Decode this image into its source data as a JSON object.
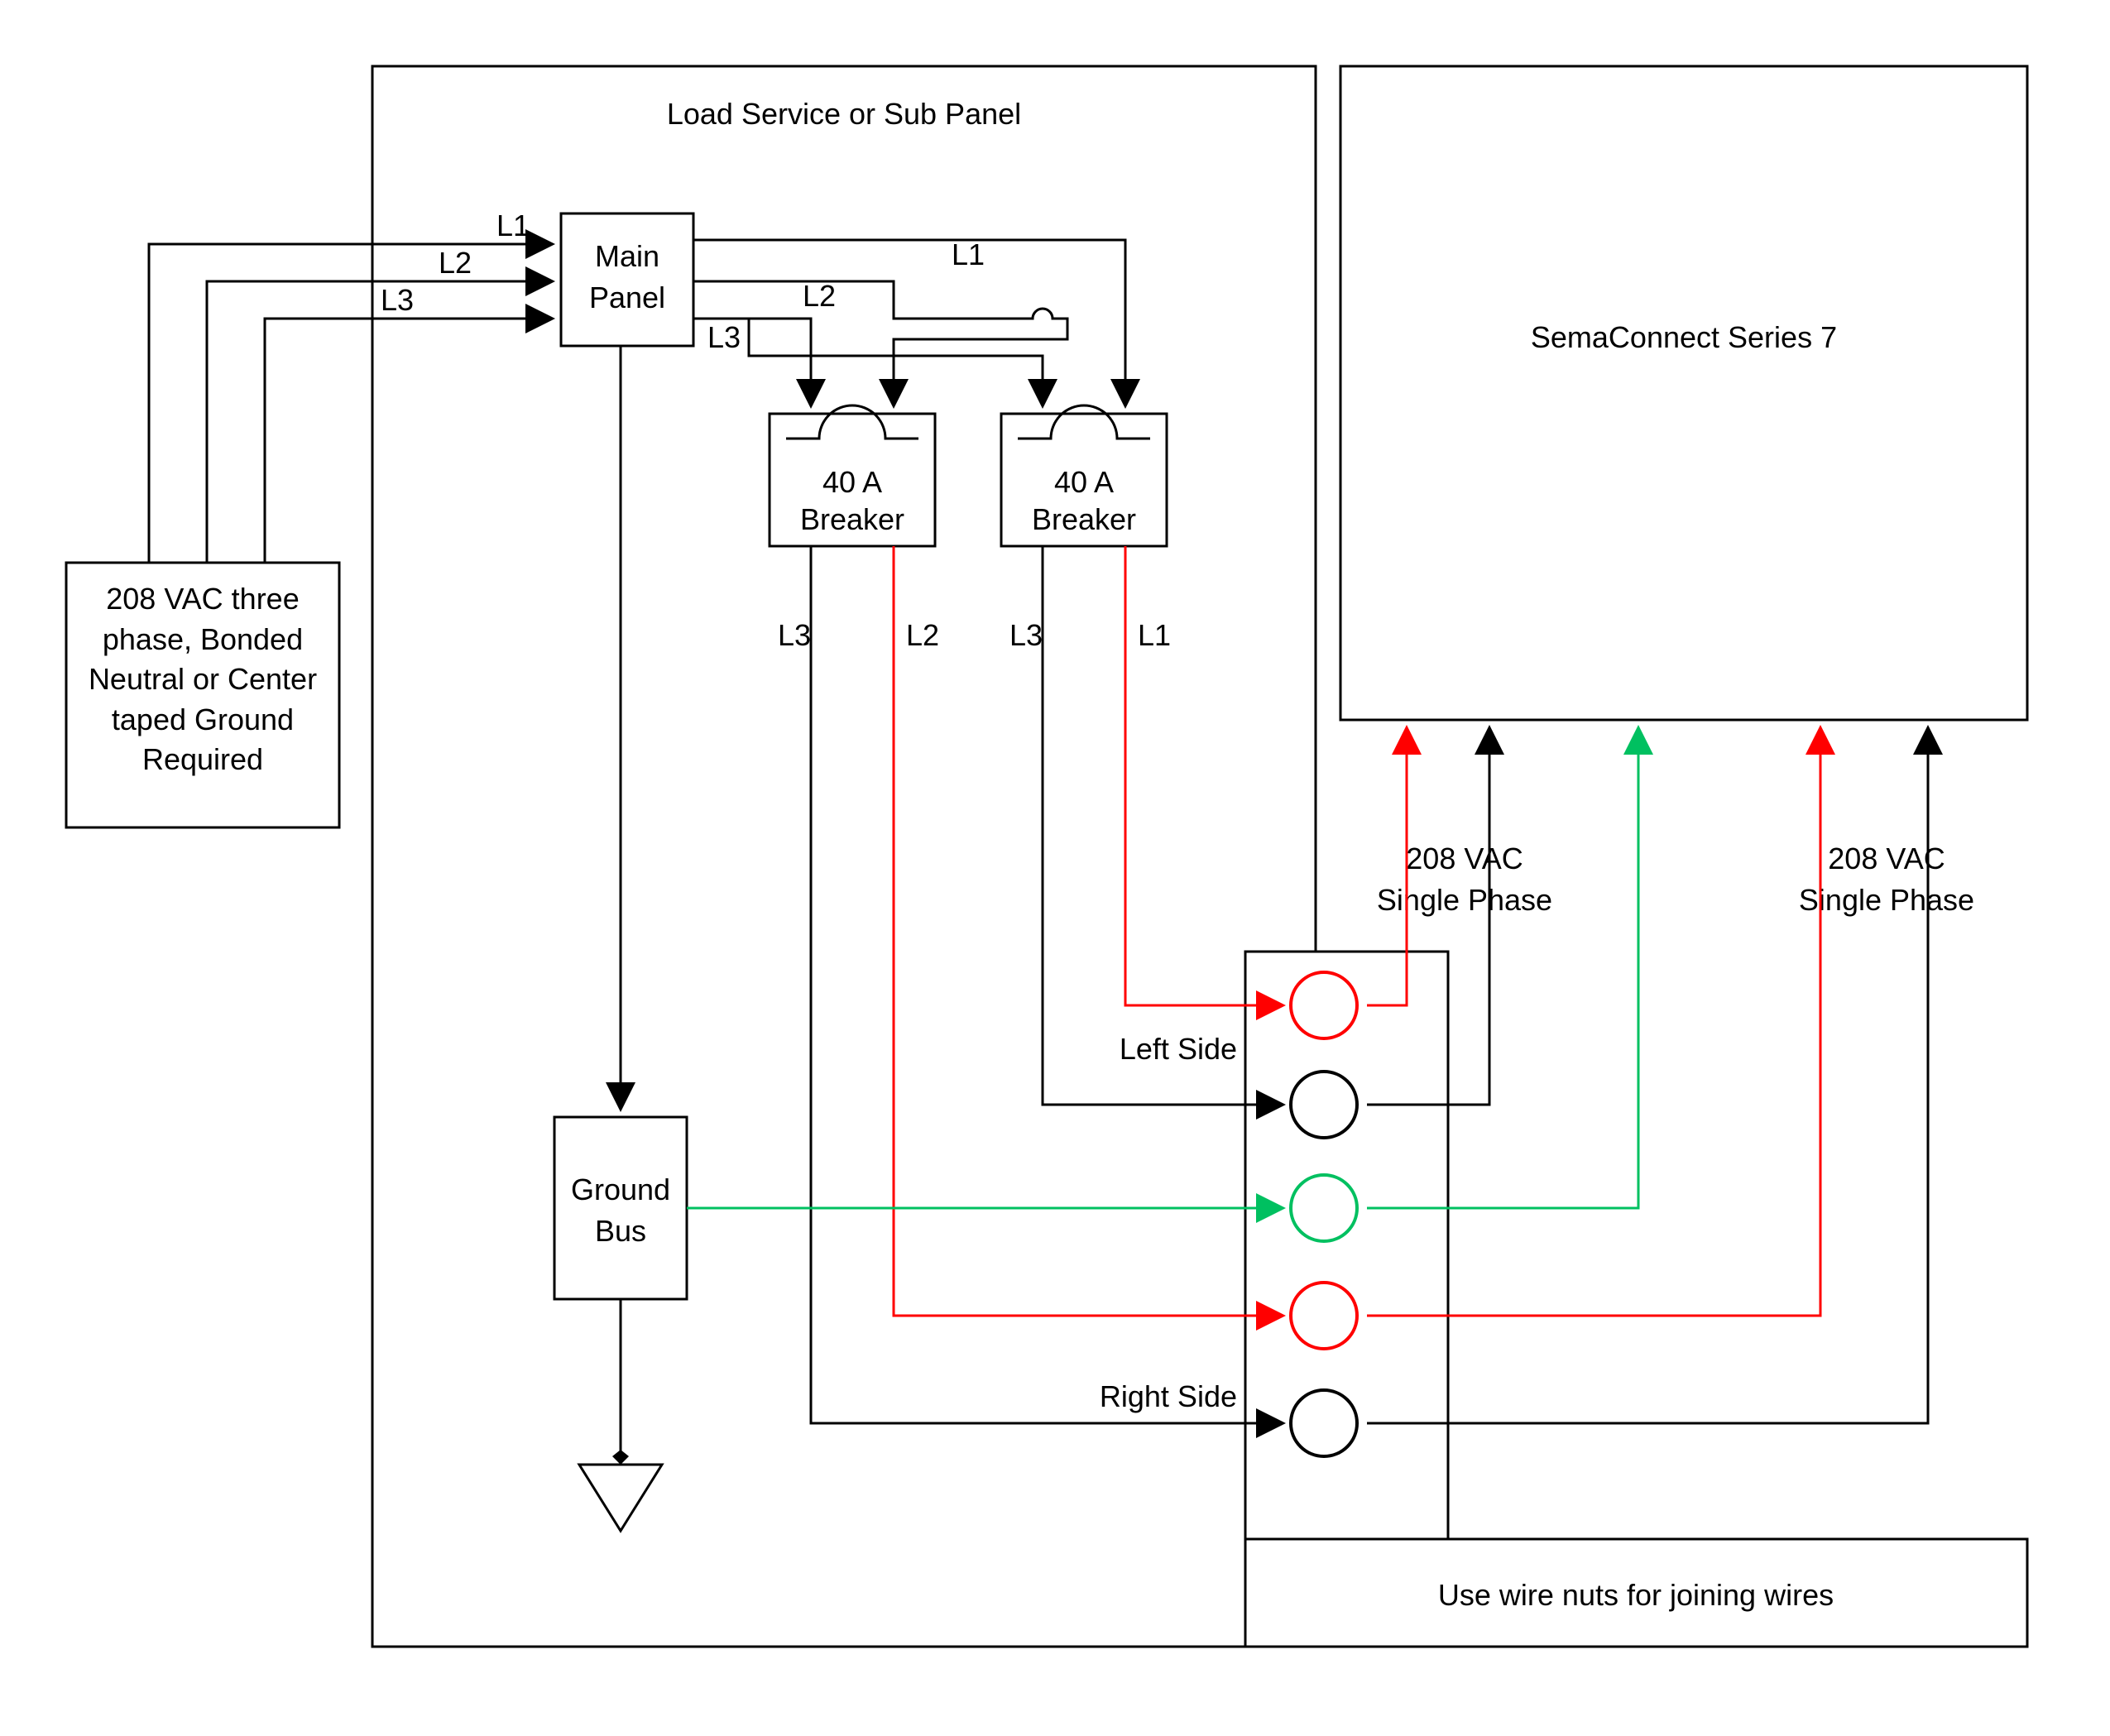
{
  "panel_title": "Load Service or Sub Panel",
  "supply_box": "208 VAC three phase, Bonded Neutral or Center taped Ground Required",
  "main_panel": "Main Panel",
  "breaker1": "40 A Breaker",
  "breaker2": "40 A Breaker",
  "ground_bus": "Ground Bus",
  "device_box": "SemaConnect Series 7",
  "note_box": "Use wire nuts for joining wires",
  "left_side": "Left Side",
  "right_side": "Right Side",
  "labels": {
    "L1": "L1",
    "L2": "L2",
    "L3": "L3"
  },
  "phase_label": "208 VAC Single Phase"
}
